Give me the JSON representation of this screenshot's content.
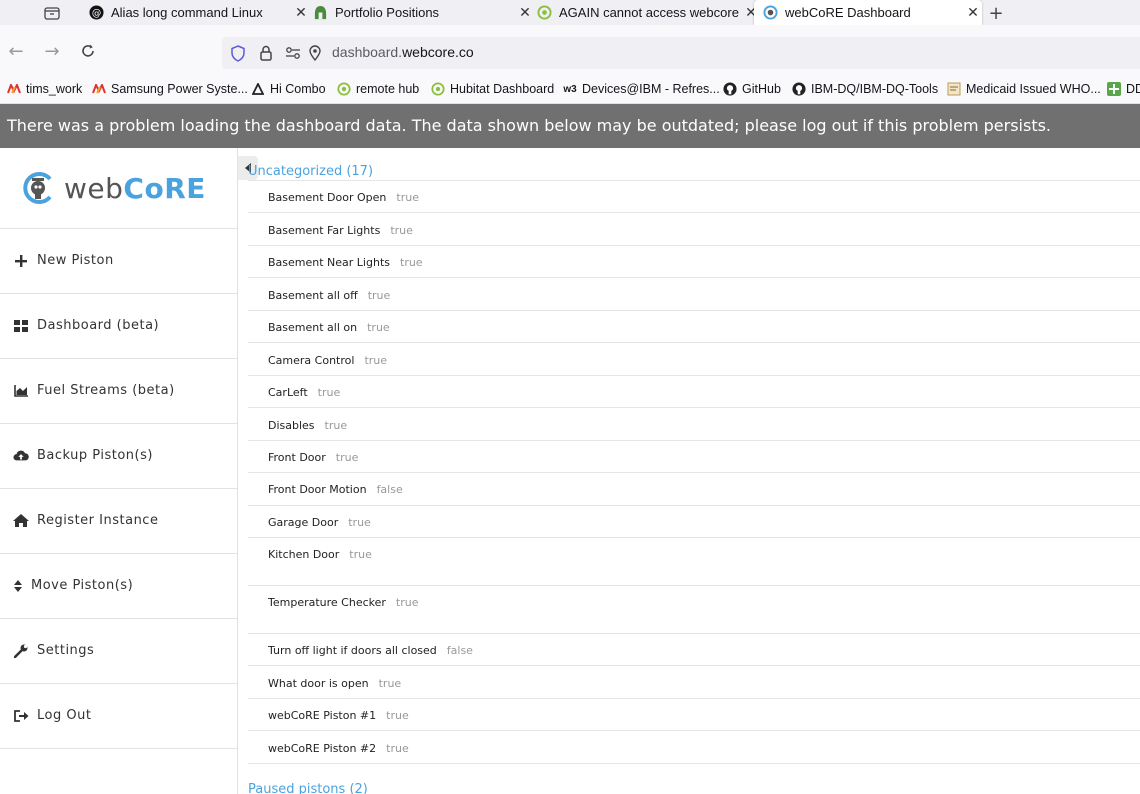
{
  "browser": {
    "tabs": [
      {
        "title": "Alias long command Linux",
        "icon": "threads-icon"
      },
      {
        "title": "Portfolio Positions",
        "icon": "fidelity-icon"
      },
      {
        "title": "AGAIN cannot access webcore p",
        "icon": "hubitat-icon"
      },
      {
        "title": "webCoRE Dashboard",
        "icon": "webcore-icon",
        "active": true
      }
    ],
    "url_prefix": "dashboard.",
    "url_domain": "webcore.co",
    "bookmarks": [
      {
        "label": "tims_work",
        "icon": "red-m-icon"
      },
      {
        "label": "Samsung Power Syste...",
        "icon": "red-m-icon"
      },
      {
        "label": "Hi Combo",
        "icon": "triangle-icon"
      },
      {
        "label": "remote hub",
        "icon": "hubitat-icon"
      },
      {
        "label": "Hubitat Dashboard",
        "icon": "hubitat-icon"
      },
      {
        "label": "Devices@IBM - Refres...",
        "icon": "w3-icon",
        "icon_text": "w3"
      },
      {
        "label": "GitHub",
        "icon": "github-icon"
      },
      {
        "label": "IBM-DQ/IBM-DQ-Tools",
        "icon": "github-icon"
      },
      {
        "label": "Medicaid Issued WHO...",
        "icon": "doc-icon"
      },
      {
        "label": "DD",
        "icon": "green-plus-icon"
      }
    ]
  },
  "banner": {
    "text": "There was a problem loading the dashboard data. The data shown below may be outdated; please log out if this problem persists."
  },
  "logo": {
    "text_web": "web",
    "text_core": "CoRE"
  },
  "sidebar": {
    "items": [
      {
        "label": "New Piston",
        "icon": "plus-icon"
      },
      {
        "label": "Dashboard (beta)",
        "icon": "grid-icon"
      },
      {
        "label": "Fuel Streams (beta)",
        "icon": "area-chart-icon"
      },
      {
        "label": "Backup Piston(s)",
        "icon": "cloud-upload-icon"
      },
      {
        "label": "Register Instance",
        "icon": "home-icon"
      },
      {
        "label": "Move Piston(s)",
        "icon": "sort-icon"
      },
      {
        "label": "Settings",
        "icon": "wrench-icon"
      },
      {
        "label": "Log Out",
        "icon": "sign-out-icon"
      }
    ]
  },
  "main": {
    "section_title": "Uncategorized (17)",
    "pistons": [
      {
        "name": "Basement Door Open",
        "value": "true"
      },
      {
        "name": "Basement Far Lights",
        "value": "true"
      },
      {
        "name": "Basement Near Lights",
        "value": "true"
      },
      {
        "name": "Basement all off",
        "value": "true"
      },
      {
        "name": "Basement all on",
        "value": "true"
      },
      {
        "name": "Camera Control",
        "value": "true"
      },
      {
        "name": "CarLeft",
        "value": "true"
      },
      {
        "name": "Disables",
        "value": "true"
      },
      {
        "name": "Front Door",
        "value": "true"
      },
      {
        "name": "Front Door Motion",
        "value": "false"
      },
      {
        "name": "Garage Door",
        "value": "true"
      },
      {
        "name": "Kitchen Door",
        "value": "true"
      },
      {
        "name": "Temperature Checker",
        "value": "true"
      },
      {
        "name": "Turn off light if doors all closed",
        "value": "false"
      },
      {
        "name": "What door is open",
        "value": "true"
      },
      {
        "name": "webCoRE Piston #1",
        "value": "true"
      },
      {
        "name": "webCoRE Piston #2",
        "value": "true"
      }
    ],
    "paused_title": "Paused pistons (2)"
  },
  "colors": {
    "accent": "#4aa3df",
    "banner_bg": "#707070",
    "muted": "#999999"
  }
}
